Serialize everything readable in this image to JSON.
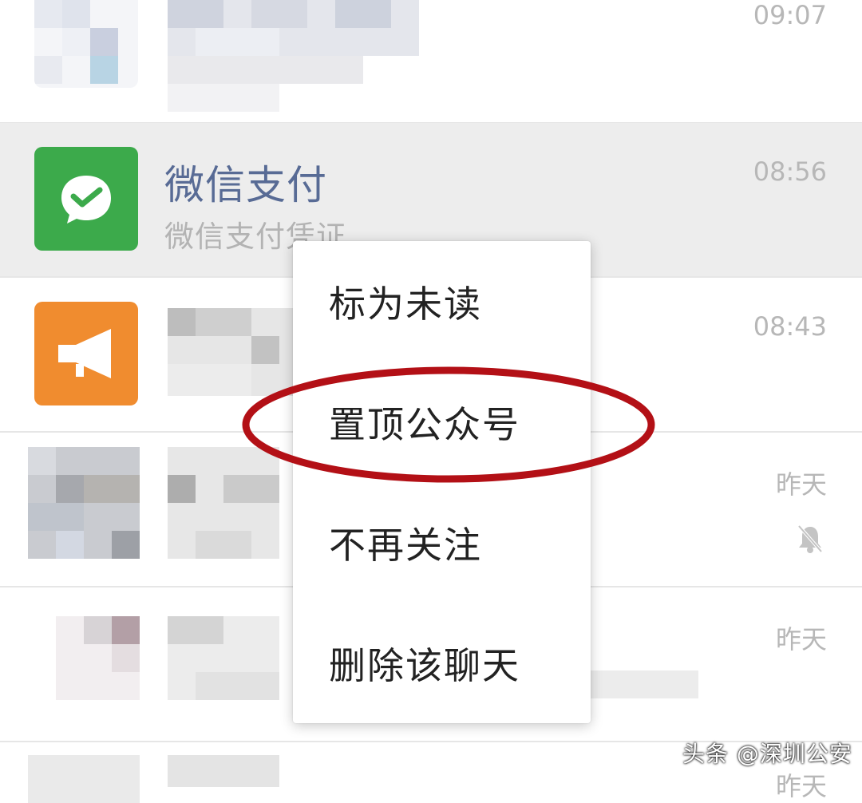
{
  "chats": [
    {
      "time": "09:07"
    },
    {
      "title": "微信支付",
      "subtitle": "微信支付凭证",
      "time": "08:56",
      "icon": "wechat-pay-icon"
    },
    {
      "time": "08:43",
      "icon": "megaphone-icon"
    },
    {
      "time": "昨天",
      "muted_icon": "muted-bell-icon"
    },
    {
      "time": "昨天"
    },
    {
      "time": "昨天"
    }
  ],
  "context_menu": {
    "items": [
      "标为未读",
      "置顶公众号",
      "不再关注",
      "删除该聊天"
    ],
    "highlighted_item": "置顶公众号",
    "highlight_color": "#b31016"
  },
  "watermark": "头条 @深圳公安",
  "colors": {
    "wechat_pay_green": "#3caa4b",
    "notice_orange": "#f08c2f",
    "title_blue": "#586b95",
    "selected_row_bg": "#ededed"
  }
}
